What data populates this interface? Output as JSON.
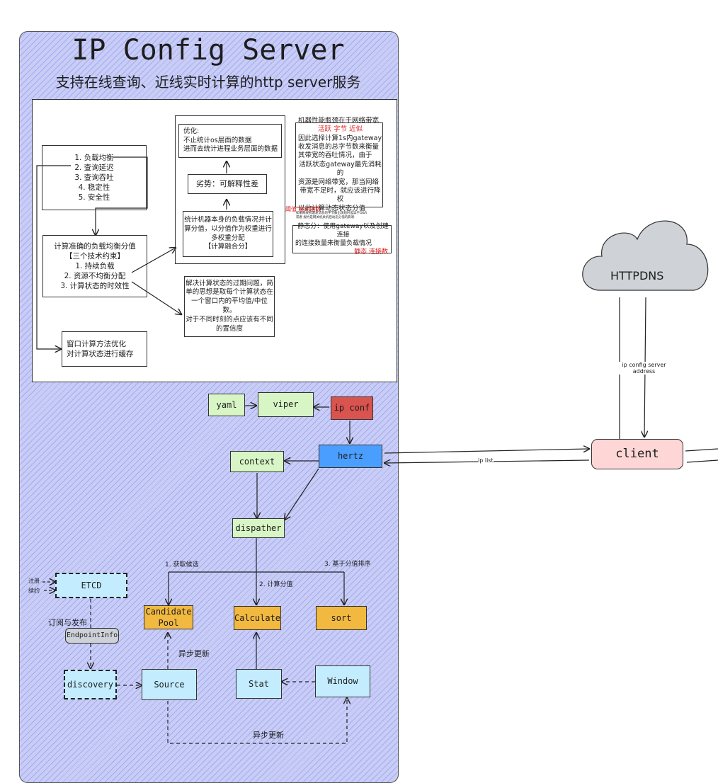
{
  "title": "IP Config Server",
  "subtitle": "支持在线查询、近线实时计算的http server服务",
  "panel": {
    "goals": [
      "1. 负载均衡",
      "2. 查询延迟",
      "3. 查询吞吐",
      "4. 稳定性",
      "5. 安全性"
    ],
    "constraints": [
      "计算准确的负载均衡分值",
      "【三个技术约束】",
      "1. 持续负载",
      "2. 资源不均衡分配",
      "3. 计算状态的时效性"
    ],
    "cache": [
      "窗口计算方法优化",
      "对计算状态进行缓存"
    ],
    "optimize": [
      "优化:",
      "不止统计os层面的数据",
      "进而去统计进程业务层面的数据"
    ],
    "weakness": "劣势：可解释性差",
    "fusion": [
      "统计机器本身的负载情况并计",
      "算分值，以分值作为权重进行",
      "多权重分配",
      "【计算融合分】"
    ],
    "window": [
      "解决计算状态的过期问题，简",
      "单的思想是取每个计算状态在",
      "一个窗口内的平均值/中位数。",
      "对于不同时刻的点应该有不同",
      "的置信度"
    ],
    "dynamic": [
      "机器性能瓶颈在于网络带宽",
      "因此选择计算1s内gateway",
      "收发消息的总字节数来衡量",
      "其带宽的吞吐情况，由于",
      "活跃状态gateway最先消耗的",
      "资源是网络带宽，那当网络",
      "带宽不足时，就应该进行降权",
      "以此计算动态状态分值"
    ],
    "dynamic_tag": "活跃 字节 近似",
    "threshold_tag": "阈值 滚动函数",
    "threshold_note": [
      "如果网关机收发消息的字节数出现短时差异于O&R",
      "或者 规约是网关机关机后动态分值的影响"
    ],
    "static": [
      "静态分：使用gateway以及创建连接",
      "的连接数量来衡量负载情况"
    ],
    "static_tag": "静态 连接数"
  },
  "nodes": {
    "yaml": "yaml",
    "viper": "viper",
    "ipconf": "ip conf",
    "hertz": "hertz",
    "context": "context",
    "dispatcher": "dispather",
    "candidate": "Candidate Pool",
    "calculate": "Calculate",
    "sort": "sort",
    "etcd": "ETCD",
    "endpoint": "EndpointInfo",
    "discovery": "discovery",
    "source": "Source",
    "stat": "Stat",
    "window": "Window",
    "httpdns": "HTTPDNS",
    "client": "client"
  },
  "labels": {
    "step1": "1. 获取候选",
    "step2": "2. 计算分值",
    "step3": "3. 基于分值排序",
    "register": "注册",
    "renew": "续约",
    "subscribe": "订阅与发布",
    "async1": "异步更新",
    "async2": "异步更新",
    "iplist": "ip list",
    "address": "ip config server address"
  },
  "colors": {
    "background": "#c9cdf6",
    "green": "#d8f5c6",
    "blue": "#c3ecff",
    "orange": "#f2b940",
    "ipconf": "#d9534f",
    "hertz": "#4a9eff",
    "client": "#ffd6d6",
    "cloud": "#cfd2d6"
  }
}
